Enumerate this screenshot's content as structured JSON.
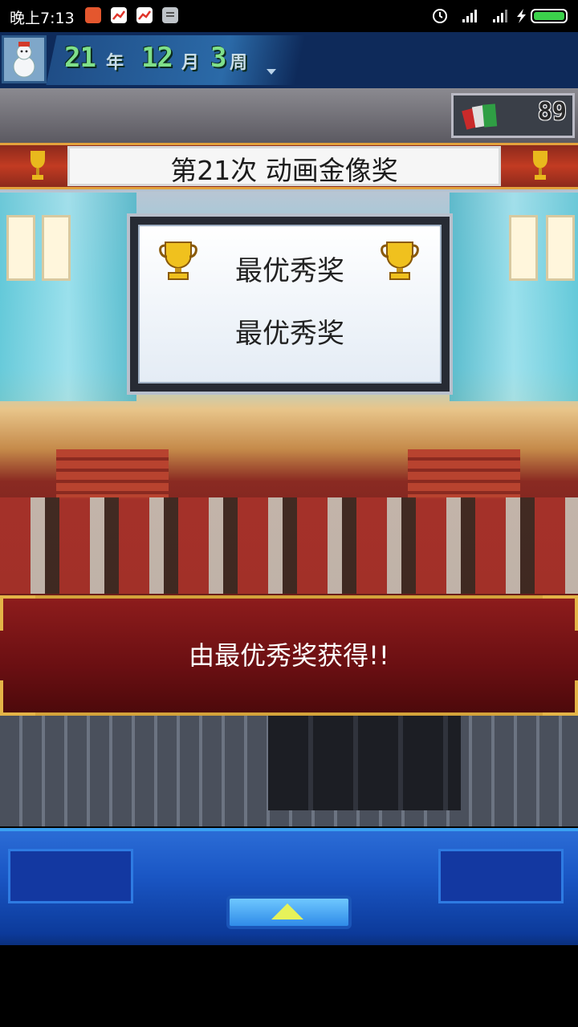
{
  "status_bar": {
    "time": "晚上7:13"
  },
  "date": {
    "year_num": "21",
    "year_unit": "年",
    "month_num": "12",
    "month_unit": "月",
    "week_num": "3",
    "week_unit": "周"
  },
  "money": {
    "value": "89",
    "icon": "money-stack-icon"
  },
  "award": {
    "title": "第21次 动画金像奖",
    "category": "最优秀奖",
    "winner": "最优秀奖"
  },
  "dialog": {
    "message": "由最优秀奖获得!!"
  },
  "colors": {
    "menu_blue": "#1a56c4",
    "dialog_red": "#6a0f12",
    "date_green": "#7fe08a",
    "gold": "#d4a33a"
  }
}
